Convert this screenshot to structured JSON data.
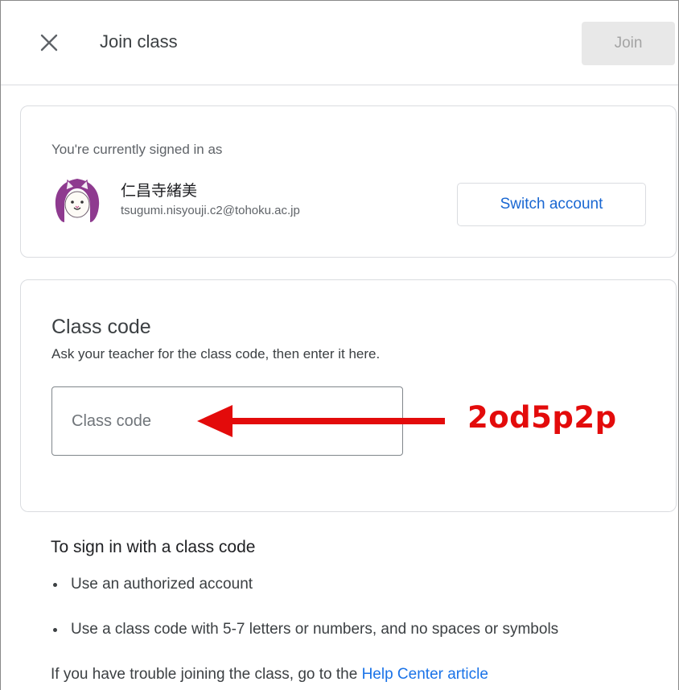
{
  "header": {
    "title": "Join class",
    "join_label": "Join"
  },
  "account": {
    "signed_in_label": "You're currently signed in as",
    "name": "仁昌寺緒美",
    "email": "tsugumi.nisyouji.c2@tohoku.ac.jp",
    "switch_label": "Switch account",
    "avatar_icon": "cat-avatar-icon"
  },
  "class_code": {
    "title": "Class code",
    "description": "Ask your teacher for the class code, then enter it here.",
    "input_placeholder": "Class code",
    "input_value": ""
  },
  "annotation": {
    "code": "2od5p2p",
    "color": "#e30b0b"
  },
  "info": {
    "title": "To sign in with a class code",
    "bullets": [
      "Use an authorized account",
      "Use a class code with 5-7 letters or numbers, and no spaces or symbols"
    ],
    "help_prefix": "If you have trouble joining the class, go to the ",
    "help_link": "Help Center article"
  },
  "colors": {
    "link": "#1a73e8",
    "button_text": "#1967d2",
    "disabled_bg": "#e8e8e8",
    "avatar_accent": "#8e3a8f"
  }
}
